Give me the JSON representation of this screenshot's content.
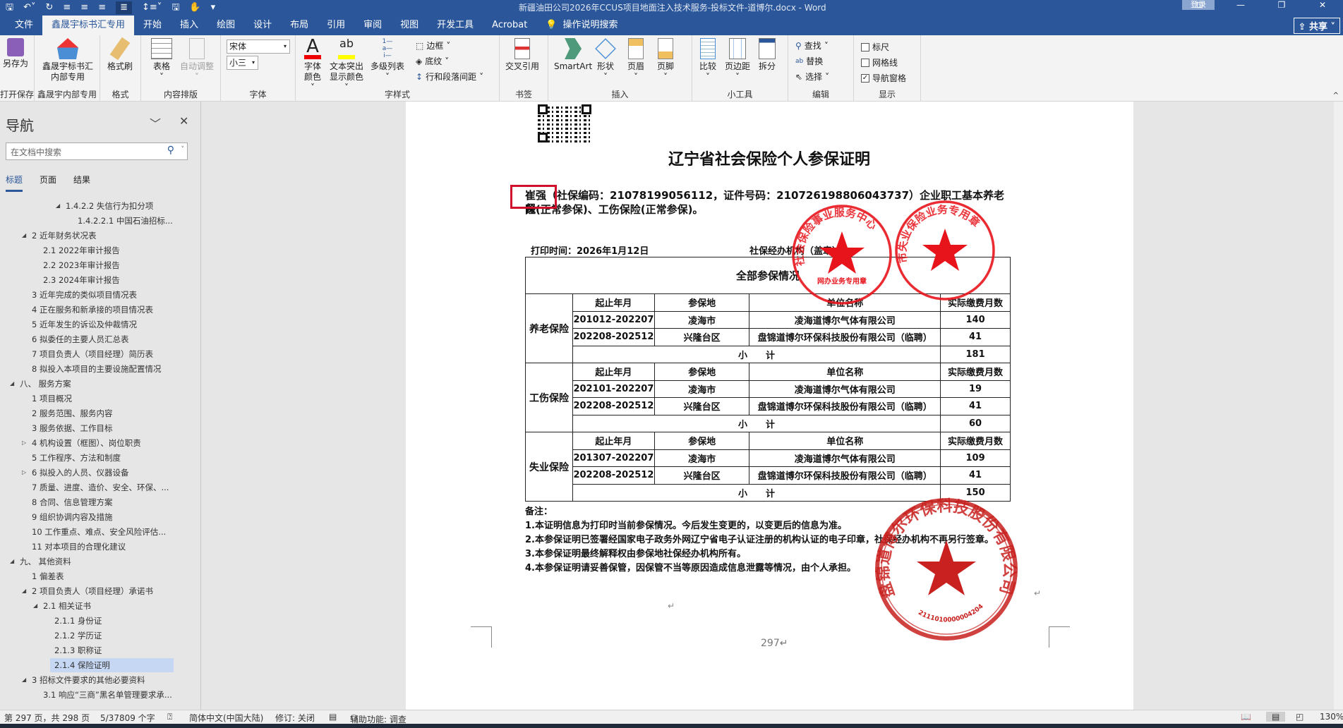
{
  "titlebar": {
    "title": "新疆油田公司2026年CCUS项目地面注入技术服务-投标文件-道博尔.docx  -  Word",
    "login": "登录",
    "qat": [
      "save-icon",
      "undo-icon",
      "redo-icon",
      "align-left-icon",
      "align-center-icon",
      "align-right-icon",
      "justify-icon",
      "line-spacing-icon",
      "save-as-icon",
      "touch-mode-icon",
      "customize-icon"
    ]
  },
  "tabs": [
    "文件",
    "鑫晟宇标书汇专用",
    "开始",
    "插入",
    "绘图",
    "设计",
    "布局",
    "引用",
    "审阅",
    "视图",
    "开发工具",
    "Acrobat"
  ],
  "tell_me": "操作说明搜索",
  "share": "共享",
  "ribbon": {
    "save_as": "另存为",
    "g_save": "打开保存",
    "internal": "鑫晟宇标书汇内部专用",
    "g_internal": "鑫晟宇内部专用",
    "format_painter": "格式刷",
    "g_format": "格式",
    "table": "表格",
    "autofit": "自动调整",
    "g_layout": "内容排版",
    "font": "宋体",
    "size": "小三",
    "g_font": "字体",
    "font_color": "字体颜色",
    "highlight": "文本突出显示颜色",
    "multilevel": "多级列表",
    "border": "边框",
    "shading": "底纹",
    "spacing": "行和段落间距",
    "g_style": "字样式",
    "crossref": "交叉引用",
    "g_bookmark": "书签",
    "smartart": "SmartArt",
    "shapes": "形状",
    "header": "页眉",
    "footer": "页脚",
    "g_insert": "插入",
    "compare": "比较",
    "margins": "页边距",
    "split": "拆分",
    "g_tools": "小工具",
    "find": "查找",
    "replace": "替换",
    "select": "选择",
    "g_edit": "编辑",
    "ruler": "标尺",
    "gridlines": "网格线",
    "navpane": "导航窗格",
    "g_show": "显示",
    "ruler_checked": false,
    "gridlines_checked": false,
    "navpane_checked": true,
    "accent": "#2b579a"
  },
  "nav": {
    "title": "导航",
    "search_placeholder": "在文档中搜索",
    "tabs": [
      "标题",
      "页面",
      "结果"
    ],
    "items": [
      {
        "label": "1.4.2.2 失信行为扣分项",
        "level": 4,
        "state": "expanded"
      },
      {
        "label": "1.4.2.2.1 中国石油招标...",
        "level": 5,
        "state": "none"
      },
      {
        "label": "2 近年财务状况表",
        "level": 1,
        "state": "expanded"
      },
      {
        "label": "2.1 2022年审计报告",
        "level": 2,
        "state": "none"
      },
      {
        "label": "2.2 2023年审计报告",
        "level": 2,
        "state": "none"
      },
      {
        "label": "2.3 2024年审计报告",
        "level": 2,
        "state": "none"
      },
      {
        "label": "3 近年完成的类似项目情况表",
        "level": 1,
        "state": "none"
      },
      {
        "label": "4 正在服务和新承接的项目情况表",
        "level": 1,
        "state": "none"
      },
      {
        "label": "5 近年发生的诉讼及仲裁情况",
        "level": 1,
        "state": "none"
      },
      {
        "label": "6 拟委任的主要人员汇总表",
        "level": 1,
        "state": "none"
      },
      {
        "label": "7 项目负责人（项目经理）简历表",
        "level": 1,
        "state": "none"
      },
      {
        "label": "8 拟投入本项目的主要设施配置情况",
        "level": 1,
        "state": "none"
      },
      {
        "label": "八、 服务方案",
        "level": 0,
        "state": "expanded"
      },
      {
        "label": "1 项目概况",
        "level": 1,
        "state": "none"
      },
      {
        "label": "2 服务范围、服务内容",
        "level": 1,
        "state": "none"
      },
      {
        "label": "3 服务依据、工作目标",
        "level": 1,
        "state": "none"
      },
      {
        "label": "4 机构设置（框图）、岗位职责",
        "level": 1,
        "state": "collapsed"
      },
      {
        "label": "5 工作程序、方法和制度",
        "level": 1,
        "state": "none"
      },
      {
        "label": "6 拟投入的人员、仪器设备",
        "level": 1,
        "state": "collapsed"
      },
      {
        "label": "7 质量、进度、造价、安全、环保、...",
        "level": 1,
        "state": "none"
      },
      {
        "label": "8 合同、信息管理方案",
        "level": 1,
        "state": "none"
      },
      {
        "label": "9 组织协调内容及措施",
        "level": 1,
        "state": "none"
      },
      {
        "label": "10 工作重点、难点、安全风险评估...",
        "level": 1,
        "state": "none"
      },
      {
        "label": "11 对本项目的合理化建议",
        "level": 1,
        "state": "none"
      },
      {
        "label": "九、 其他资料",
        "level": 0,
        "state": "expanded"
      },
      {
        "label": "1 偏差表",
        "level": 1,
        "state": "none"
      },
      {
        "label": "2 项目负责人（项目经理）承诺书",
        "level": 1,
        "state": "expanded"
      },
      {
        "label": "2.1 相关证书",
        "level": 2,
        "state": "expanded"
      },
      {
        "label": "2.1.1 身份证",
        "level": 3,
        "state": "none"
      },
      {
        "label": "2.1.2 学历证",
        "level": 3,
        "state": "none"
      },
      {
        "label": "2.1.3 职称证",
        "level": 3,
        "state": "none"
      },
      {
        "label": "2.1.4 保险证明",
        "level": 3,
        "state": "none",
        "selected": true
      },
      {
        "label": "3 招标文件要求的其他必要资料",
        "level": 1,
        "state": "expanded"
      },
      {
        "label": "3.1 响应“三商”黑名单管理要求承...",
        "level": 2,
        "state": "none"
      }
    ]
  },
  "document": {
    "title": "辽宁省社会保险个人参保证明",
    "name": "崔强",
    "line1": "（社保编码：21078199056112，证件号码：210726198806043737）企业职工基本养老保",
    "line2": "险(正常参保)、工伤保险(正常参保)。",
    "print_time": "打印时间：2026年1月12日",
    "agency": "社保经办机构（盖章）",
    "table_title": "全部参保情况",
    "headers": [
      "起止年月",
      "参保地",
      "单位名称",
      "实际缴费月数"
    ],
    "subtotal_label": "小　　计",
    "sections": [
      {
        "type": "养老保险",
        "rows": [
          [
            "201012-202207",
            "凌海市",
            "凌海道博尔气体有限公司",
            "140"
          ],
          [
            "202208-202512",
            "兴隆台区",
            "盘锦道博尔环保科技股份有限公司（临聘）",
            "41"
          ]
        ],
        "subtotal": "181"
      },
      {
        "type": "工伤保险",
        "rows": [
          [
            "202101-202207",
            "凌海市",
            "凌海道博尔气体有限公司",
            "19"
          ],
          [
            "202208-202512",
            "兴隆台区",
            "盘锦道博尔环保科技股份有限公司（临聘）",
            "41"
          ]
        ],
        "subtotal": "60"
      },
      {
        "type": "失业保险",
        "rows": [
          [
            "201307-202207",
            "凌海市",
            "凌海道博尔气体有限公司",
            "109"
          ],
          [
            "202208-202512",
            "兴隆台区",
            "盘锦道博尔环保科技股份有限公司（临聘）",
            "41"
          ]
        ],
        "subtotal": "150"
      }
    ],
    "notes_title": "备注：",
    "notes": [
      "1.本证明信息为打印时当前参保情况。今后发生变更的，以变更后的信息为准。",
      "2.本参保证明已签署经国家电子政务外网辽宁省电子认证注册的机构认证的电子印章，社保经办机构不再另行签章。",
      "3.本参保证明最终解释权由参保地社保经办机构所有。",
      "4.本参保证明请妥善保管，因保管不当等原因造成信息泄露等情况，由个人承担。"
    ],
    "page_number": "297",
    "stamps": {
      "s1_ring": "社会保险事业服务中心",
      "s1_center": "网办业务专用章",
      "s2_ring": "市失业保险业务专用章",
      "s3_ring": "盘锦道博尔环保科技股份有限公司",
      "s3_code": "2111010000004204",
      "stamp_color": "#e8141c",
      "stamp3_color": "#c8211f"
    }
  },
  "status": {
    "page": "第 297 页，共 298 页",
    "words": "5/37809 个字",
    "language": "简体中文(中国大陆)",
    "track": "修订: 关闭",
    "accessibility": "辅助功能: 调查",
    "zoom": "130%"
  }
}
